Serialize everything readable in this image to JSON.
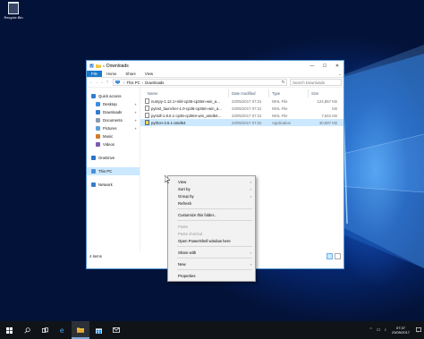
{
  "desktop": {
    "icons": [
      {
        "label": "Recycle Bin",
        "icon": "recycle-bin-icon"
      }
    ]
  },
  "window": {
    "title": "Downloads",
    "ribbon_tabs": [
      "File",
      "Home",
      "Share",
      "View"
    ],
    "address": {
      "segments": [
        "This PC",
        "Downloads"
      ]
    },
    "search_placeholder": "Search Downloads",
    "nav": [
      {
        "label": "Quick access",
        "icon": "star-icon",
        "color": "#2d7dd2"
      },
      {
        "label": "Desktop",
        "icon": "desktop-icon",
        "color": "#3a8ee6",
        "pinned": true
      },
      {
        "label": "Downloads",
        "icon": "download-icon",
        "color": "#2d7dd2",
        "pinned": true
      },
      {
        "label": "Documents",
        "icon": "documents-icon",
        "color": "#8a9bb0",
        "pinned": true
      },
      {
        "label": "Pictures",
        "icon": "pictures-icon",
        "color": "#5aa0d8",
        "pinned": true
      },
      {
        "label": "Music",
        "icon": "music-icon",
        "color": "#d07b2b"
      },
      {
        "label": "Videos",
        "icon": "videos-icon",
        "color": "#7b5bb3"
      },
      {
        "label": "OneDrive",
        "icon": "onedrive-icon",
        "color": "#2a72c8"
      },
      {
        "label": "This PC",
        "icon": "this-pc-icon",
        "color": "#4a90d9"
      },
      {
        "label": "Network",
        "icon": "network-icon",
        "color": "#3a7bc8"
      }
    ],
    "columns": {
      "name": "Name",
      "date": "Date modified",
      "type": "Type",
      "size": "Size"
    },
    "files": [
      {
        "name": "numpy-1.12.1+mkl-cp36-cp36m-win_a...",
        "date": "23/05/2017 07:31",
        "type": "WHL File",
        "size": "124,857 KB"
      },
      {
        "name": "pyinst_launcher-1.0-cp36-cp36m-win_a...",
        "date": "23/05/2017 07:31",
        "type": "WHL File",
        "size": "",
        "size_tail": "KB"
      },
      {
        "name": "pyrsdl-1.8.6.1-cp36-cp36m-win_amd64...",
        "date": "23/05/2017 07:31",
        "type": "WHL File",
        "size": "7,542 KB"
      },
      {
        "name": "python-3.6.1-amd64",
        "date": "23/05/2017 07:32",
        "type": "Application",
        "size": "30,597 KB"
      }
    ],
    "status": "4 items",
    "controls": {
      "minimize": "—",
      "maximize": "☐",
      "close": "✕"
    }
  },
  "context_menu": {
    "groups": [
      [
        {
          "label": "View",
          "submenu": true
        },
        {
          "label": "Sort by",
          "submenu": true
        },
        {
          "label": "Group by",
          "submenu": true
        },
        {
          "label": "Refresh"
        }
      ],
      [
        {
          "label": "Customize this folder..."
        }
      ],
      [
        {
          "label": "Paste",
          "disabled": true
        },
        {
          "label": "Paste shortcut",
          "disabled": true
        },
        {
          "label": "Open PowerShell window here"
        }
      ],
      [
        {
          "label": "Share with",
          "submenu": true
        }
      ],
      [
        {
          "label": "New",
          "submenu": true
        }
      ],
      [
        {
          "label": "Properties"
        }
      ]
    ]
  },
  "taskbar": {
    "buttons": [
      "start-icon",
      "search-icon",
      "task-view-icon",
      "file-explorer-icon",
      "store-icon",
      "settings-icon",
      "edge-icon"
    ],
    "active": "file-explorer-icon",
    "clock": {
      "time": "07:37",
      "date": "23/05/2017"
    }
  }
}
